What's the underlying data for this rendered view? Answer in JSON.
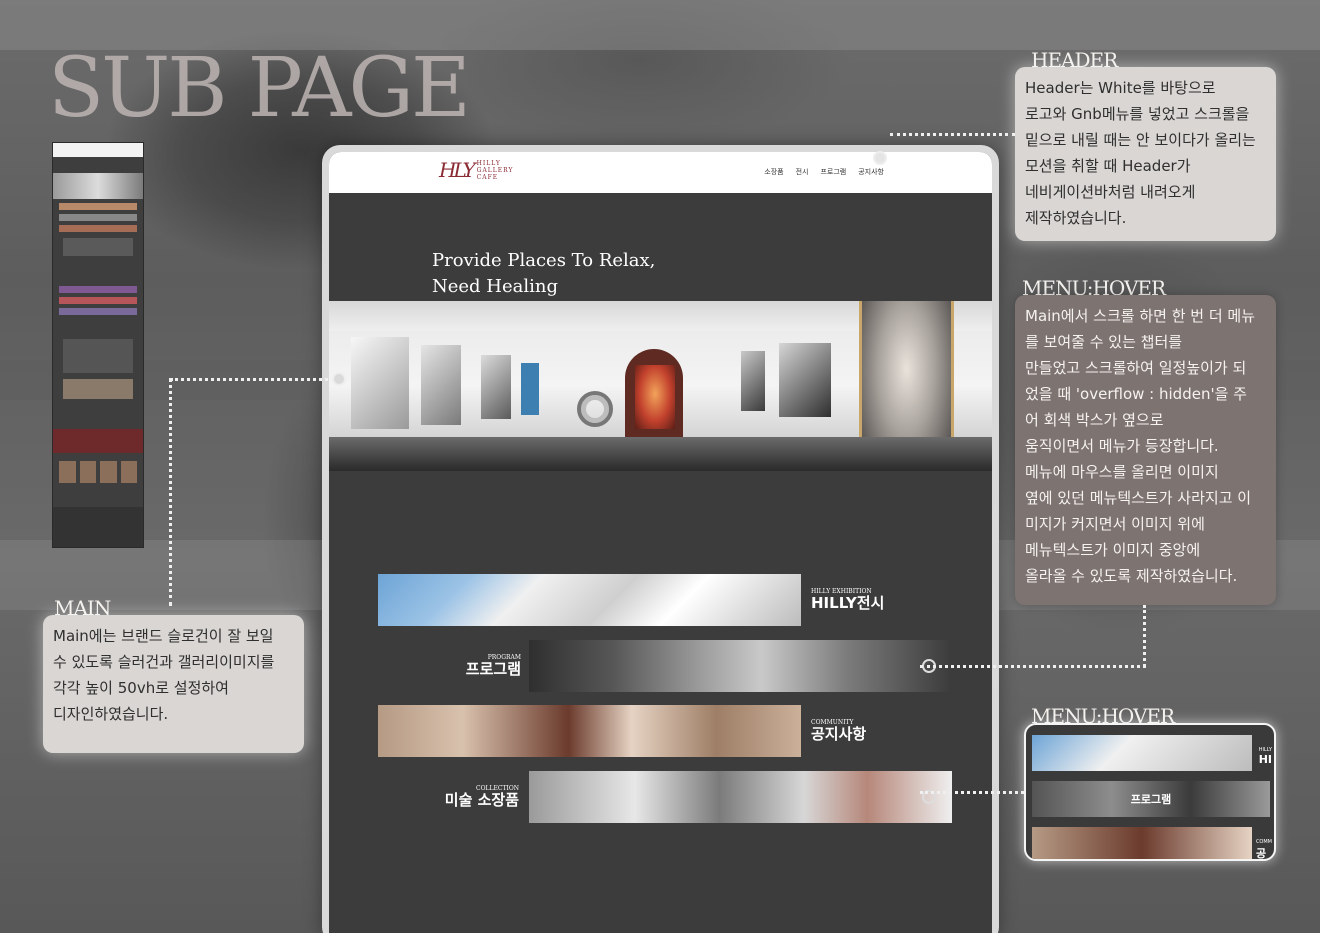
{
  "page_title": "SUB PAGE",
  "site": {
    "logo_mark": "HLY",
    "logo_lines": [
      "HILLY",
      "GALLERY",
      "CAFE"
    ],
    "nav": [
      "소장품",
      "전시",
      "프로그램",
      "공지사항"
    ],
    "hero_line1": "Provide Places To Relax,",
    "hero_line2": "Need Healing",
    "menus": [
      {
        "en": "HILLY EXHIBITION",
        "kr": "HILLY전시"
      },
      {
        "en": "PROGRAM",
        "kr": "프로그램"
      },
      {
        "en": "COMMUNITY",
        "kr": "공지사항"
      },
      {
        "en": "COLLECTION",
        "kr": "미술 소장품"
      }
    ]
  },
  "annotations": {
    "header": {
      "title": "HEADER",
      "lines": [
        "Header는 White를 바탕으로",
        "로고와 Gnb메뉴를 넣었고 스크롤을",
        "밑으로 내릴 때는 안 보이다가 올리는",
        "모션을 취할 때 Header가",
        "네비게이션바처럼 내려오게",
        "제작하였습니다."
      ]
    },
    "menu_hover": {
      "title": "MENU:HOVER",
      "lines": [
        "Main에서 스크롤 하면 한 번 더 메뉴",
        "를 보여줄 수 있는 챕터를",
        "만들었고 스크롤하여 일정높이가 되",
        "었을 때 'overflow : hidden'을 주",
        "어 회색 박스가 옆으로",
        "움직이면서 메뉴가 등장합니다.",
        "메뉴에 마우스를 올리면 이미지",
        "옆에 있던 메뉴텍스트가 사라지고 이",
        "미지가 커지면서 이미지 위에",
        "메뉴텍스트가 이미지 중앙에",
        "올라올 수 있도록 제작하였습니다."
      ]
    },
    "main": {
      "title": "MAIN",
      "lines": [
        "Main에는 브랜드 슬로건이 잘 보일",
        "수 있도록 슬러건과 갤러리이미지를",
        "각각 높이 50vh로 설정하여",
        "디자인하였습니다."
      ]
    },
    "hover_preview": {
      "title": "MENU:HOVER",
      "center_label": "프로그램",
      "side_top_en": "HILLY",
      "side_top_kr": "HI",
      "side_bottom_en": "COMM",
      "side_bottom_kr": "공"
    }
  }
}
